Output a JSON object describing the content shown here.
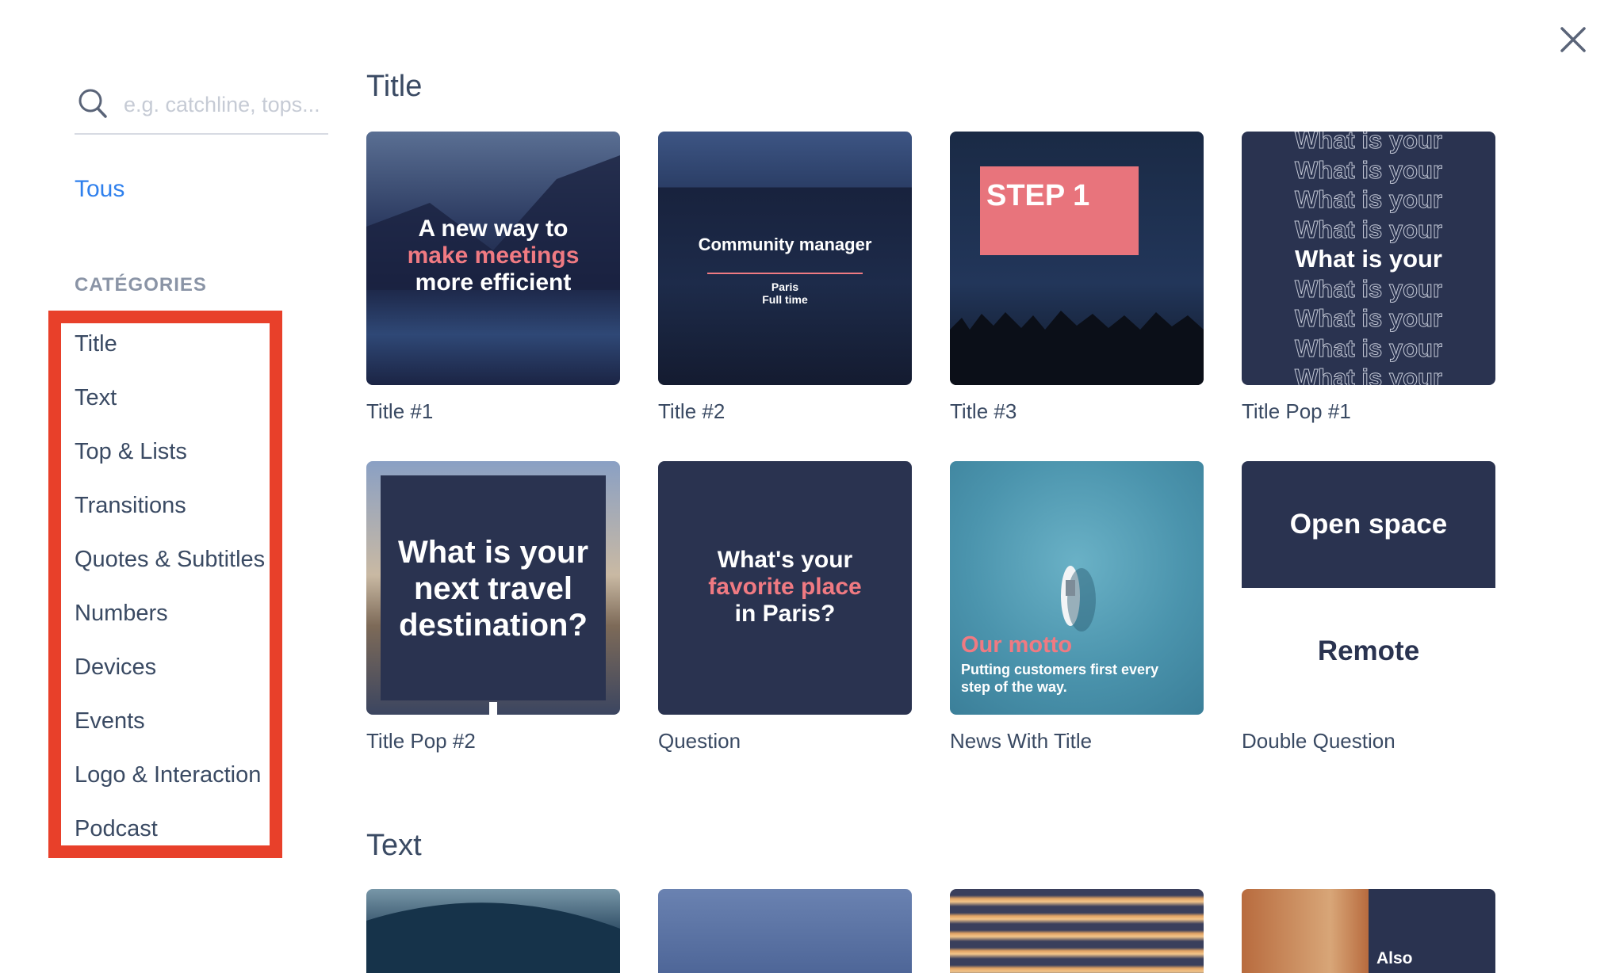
{
  "dialog": {
    "close_label": "close"
  },
  "search": {
    "placeholder": "e.g. catchline, tops..."
  },
  "sidebar": {
    "all_label": "Tous",
    "categories_heading": "CATÉGORIES",
    "categories": [
      "Title",
      "Text",
      "Top & Lists",
      "Transitions",
      "Quotes & Subtitles",
      "Numbers",
      "Devices",
      "Events",
      "Logo & Interaction",
      "Podcast"
    ]
  },
  "sections": [
    {
      "title": "Title",
      "templates": [
        {
          "label": "Title #1",
          "line1": "A new way to",
          "line2": "make meetings",
          "line3": "more efficient"
        },
        {
          "label": "Title #2",
          "heading": "Community manager",
          "sub1": "Paris",
          "sub2": "Full time"
        },
        {
          "label": "Title #3",
          "badge": "STEP 1"
        },
        {
          "label": "Title Pop #1",
          "repeat": "What is your"
        },
        {
          "label": "Title Pop #2",
          "line1": "What is your",
          "line2": "next travel",
          "line3": "destination?"
        },
        {
          "label": "Question",
          "line1": "What's your",
          "line2": "favorite place",
          "line3": "in Paris?"
        },
        {
          "label": "News With Title",
          "motto": "Our motto",
          "body1": "Putting customers first every",
          "body2": "step of the way."
        },
        {
          "label": "Double Question",
          "top": "Open space",
          "bottom": "Remote"
        }
      ]
    },
    {
      "title": "Text",
      "templates": [
        {
          "label": ""
        },
        {
          "label": ""
        },
        {
          "label": ""
        },
        {
          "label": "",
          "caption": "Also"
        }
      ]
    }
  ],
  "colors": {
    "accent": "#2f80ed",
    "highlight_border": "#e8402a",
    "navy": "#2a3350",
    "pink": "#f07a82"
  }
}
